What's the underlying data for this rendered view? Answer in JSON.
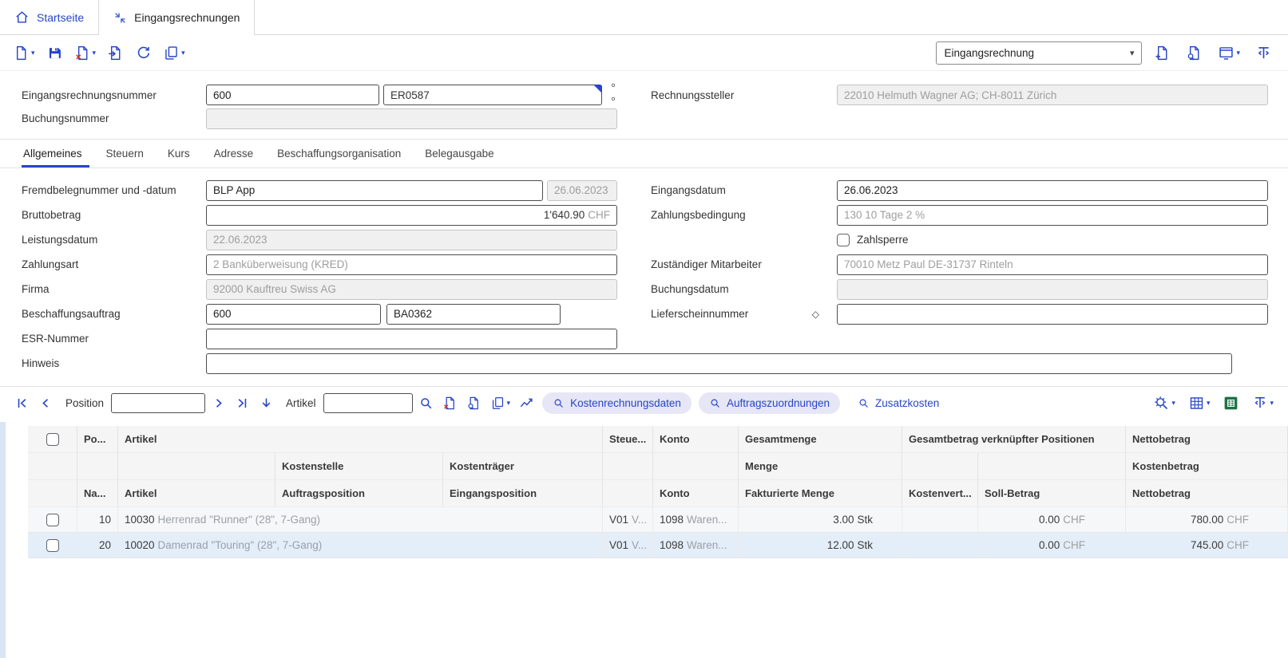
{
  "glyphs": {
    "caret_down": "▾",
    "select_caret": "▾",
    "diamond": "◇",
    "field_options": "°°"
  },
  "tabbar": {
    "home_label": "Startseite",
    "active_label": "Eingangsrechnungen"
  },
  "toolbar": {
    "doc_type_value": "Eingangsrechnung"
  },
  "record_header": {
    "nummer": {
      "label": "Eingangsrechnungsnummer",
      "value_num": "600",
      "value_code": "ER0587"
    },
    "buchungsnummer": {
      "label": "Buchungsnummer",
      "value": ""
    },
    "rechnungssteller": {
      "label": "Rechnungssteller",
      "value": "22010 Helmuth Wagner AG; CH-8011 Zürich"
    }
  },
  "tabs": {
    "items": [
      {
        "label": "Allgemeines"
      },
      {
        "label": "Steuern"
      },
      {
        "label": "Kurs"
      },
      {
        "label": "Adresse"
      },
      {
        "label": "Beschaffungsorganisation"
      },
      {
        "label": "Belegausgabe"
      }
    ]
  },
  "form": {
    "fremdbeleg": {
      "label": "Fremdbelegnummer und -datum",
      "value": "BLP App",
      "date": "26.06.2023"
    },
    "bruttobetrag": {
      "label": "Bruttobetrag",
      "amount": "1'640.90",
      "currency": "CHF"
    },
    "leistungsdatum": {
      "label": "Leistungsdatum",
      "value": "22.06.2023"
    },
    "zahlungsart": {
      "label": "Zahlungsart",
      "value": "2 Banküberweisung (KRED)"
    },
    "firma": {
      "label": "Firma",
      "value": "92000 Kauftreu Swiss AG"
    },
    "beschaffungsauftrag": {
      "label": "Beschaffungsauftrag",
      "value1": "600",
      "value2": "BA0362"
    },
    "esr": {
      "label": "ESR-Nummer",
      "value": ""
    },
    "hinweis": {
      "label": "Hinweis",
      "value": ""
    },
    "eingangsdatum": {
      "label": "Eingangsdatum",
      "value": "26.06.2023"
    },
    "zahlungsbedingung": {
      "label": "Zahlungsbedingung",
      "value": "130 10 Tage 2 %"
    },
    "zahlsperre": {
      "label": "Zahlsperre"
    },
    "mitarbeiter": {
      "label": "Zuständiger Mitarbeiter",
      "value": "70010 Metz Paul DE-31737 Rinteln"
    },
    "buchungsdatum": {
      "label": "Buchungsdatum",
      "value": ""
    },
    "lieferschein": {
      "label": "Lieferscheinnummer",
      "value": ""
    }
  },
  "positions_bar": {
    "position_label": "Position",
    "position_value": "",
    "artikel_label": "Artikel",
    "artikel_value": "",
    "kostenrechnungsdaten_label": "Kostenrechnungsdaten",
    "auftragszuordnungen_label": "Auftragszuordnungen",
    "zusatzkosten_label": "Zusatzkosten"
  },
  "table": {
    "header": {
      "row1": {
        "pos": "Po...",
        "artikel": "Artikel",
        "steuer": "Steue...",
        "konto": "Konto",
        "gesamtmenge": "Gesamtmenge",
        "gesamtbetrag": "Gesamtbetrag verknüpfter Positionen",
        "netto": "Nettobetrag"
      },
      "row2": {
        "kostenstelle": "Kostenstelle",
        "kostentraeger": "Kostenträger",
        "menge": "Menge",
        "kostenbetrag": "Kostenbetrag"
      },
      "row3": {
        "na": "Na...",
        "artikel": "Artikel",
        "auftragsposition": "Auftragsposition",
        "eingangsposition": "Eingangsposition",
        "konto": "Konto",
        "fakturierte_menge": "Fakturierte Menge",
        "kostenvert": "Kostenvert...",
        "soll": "Soll-Betrag",
        "netto": "Nettobetrag"
      }
    },
    "rows": [
      {
        "pos": "10",
        "artikel_code": "10030",
        "artikel_name": "Herrenrad \"Runner\" (28\", 7-Gang)",
        "steuer_code": "V01",
        "steuer_rest": "V...",
        "konto_code": "1098",
        "konto_rest": "Waren...",
        "menge": "3.00",
        "menge_unit": "Stk",
        "soll": "0.00",
        "soll_currency": "CHF",
        "netto": "780.00",
        "netto_currency": "CHF"
      },
      {
        "pos": "20",
        "artikel_code": "10020",
        "artikel_name": "Damenrad \"Touring\" (28\", 7-Gang)",
        "steuer_code": "V01",
        "steuer_rest": "V...",
        "konto_code": "1098",
        "konto_rest": "Waren...",
        "menge": "12.00",
        "menge_unit": "Stk",
        "soll": "0.00",
        "soll_currency": "CHF",
        "netto": "745.00",
        "netto_currency": "CHF"
      }
    ]
  }
}
